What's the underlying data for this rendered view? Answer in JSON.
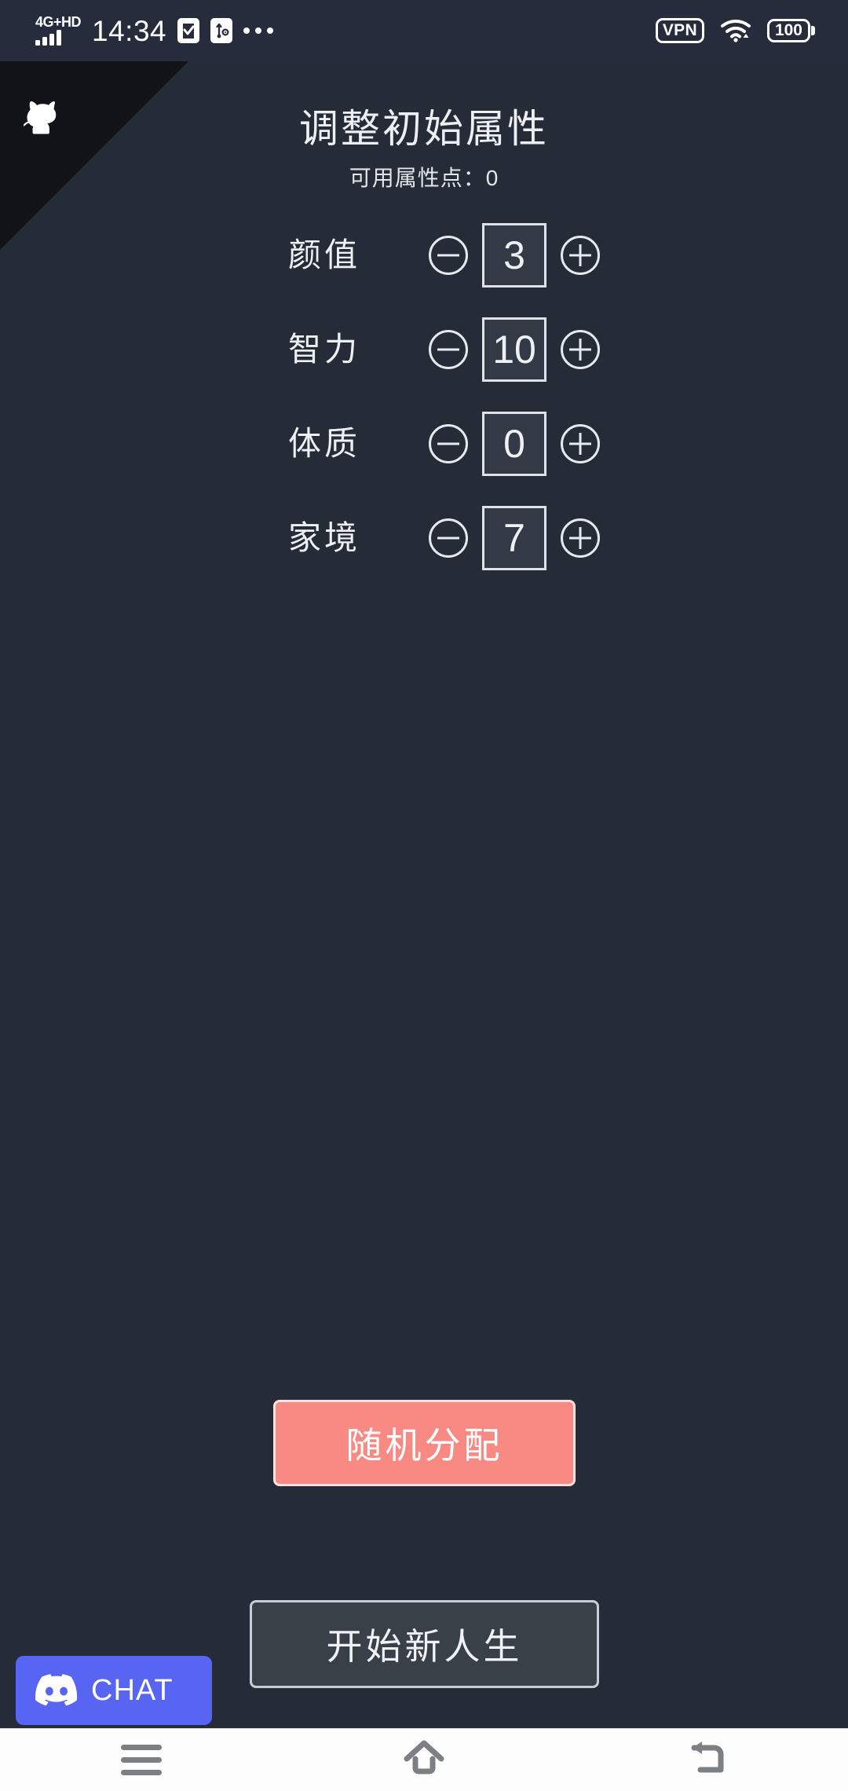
{
  "status_bar": {
    "network_label": "4G+HD",
    "time": "14:34",
    "clipboard_icon": "clipboard-check-icon",
    "usb_icon": "usb-settings-icon",
    "overflow_icon": "more-dots-icon",
    "vpn_label": "VPN",
    "wifi_icon": "wifi-icon",
    "battery_level": "100"
  },
  "github_corner": {
    "icon": "octocat-icon",
    "ribbon_color": "#111318"
  },
  "header": {
    "title": "调整初始属性",
    "points_label": "可用属性点：0"
  },
  "attributes": [
    {
      "name": "颜值",
      "value": "3",
      "decrease_label": "−",
      "increase_label": "+"
    },
    {
      "name": "智力",
      "value": "10",
      "decrease_label": "−",
      "increase_label": "+"
    },
    {
      "name": "体质",
      "value": "0",
      "decrease_label": "−",
      "increase_label": "+"
    },
    {
      "name": "家境",
      "value": "7",
      "decrease_label": "−",
      "increase_label": "+"
    }
  ],
  "buttons": {
    "random": "随机分配",
    "start": "开始新人生"
  },
  "discord": {
    "label": "CHAT",
    "icon": "discord-icon",
    "color": "#5865f2"
  },
  "nav_bar": {
    "menu": "menu-icon",
    "home": "home-icon",
    "back": "back-icon"
  },
  "colors": {
    "background": "#252b37",
    "status_bar": "#262c3c",
    "value_box": "#343a45",
    "random_button": "#f98a83",
    "start_button": "#3a4048",
    "text": "#eef0f3"
  }
}
